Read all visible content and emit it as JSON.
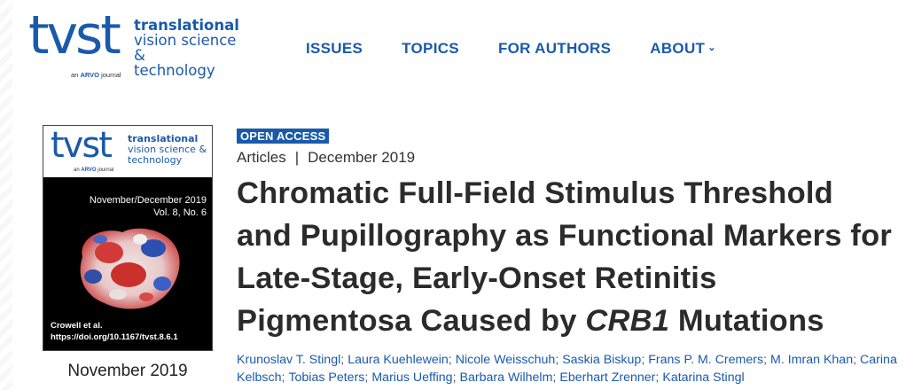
{
  "brand": {
    "logo_mark": "tvst",
    "logo_line1": "translational",
    "logo_line2": "vision science &",
    "logo_line3": "technology",
    "logo_sub_prefix": "an",
    "logo_sub_brand": "ARVO",
    "logo_sub_suffix": "journal",
    "color": "#1a5aab"
  },
  "nav": {
    "items": [
      {
        "label": "ISSUES"
      },
      {
        "label": "TOPICS"
      },
      {
        "label": "FOR AUTHORS"
      },
      {
        "label": "ABOUT",
        "chevron": "⌄"
      }
    ]
  },
  "cover": {
    "mark": "tvst",
    "line1": "translational",
    "line2": "vision science &",
    "line3": "technology",
    "sub_prefix": "an",
    "sub_brand": "ARVO",
    "sub_suffix": "journal",
    "issue_line1": "November/December 2019",
    "issue_line2": "Vol. 8, No. 6",
    "foot_line1": "Crowell et al.",
    "foot_line2": "https://doi.org/10.1167/tvst.8.6.1",
    "date": "November 2019"
  },
  "article": {
    "badge": "OPEN ACCESS",
    "section": "Articles",
    "separator": "|",
    "date": "December 2019",
    "title_part1": "Chromatic Full-Field Stimulus Threshold and Pupillography as Functional Markers for Late-Stage, Early-Onset Retinitis Pigmentosa Caused by ",
    "title_gene": "CRB1",
    "title_part2": " Mutations",
    "authors": [
      "Krunoslav T. Stingl",
      "Laura Kuehlewein",
      "Nicole Weisschuh",
      "Saskia Biskup",
      "Frans P. M. Cremers",
      "M. Imran Khan",
      "Carina Kelbsch",
      "Tobias Peters",
      "Marius Ueffing",
      "Barbara Wilhelm",
      "Eberhart Zrenner",
      "Katarina Stingl"
    ],
    "author_separator": ";"
  }
}
